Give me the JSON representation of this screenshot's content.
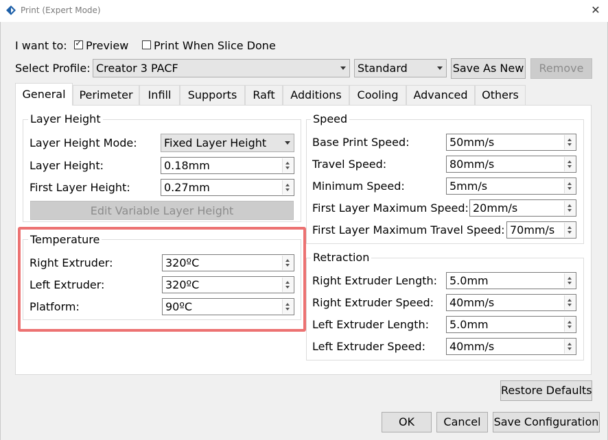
{
  "window": {
    "title": "Print (Expert Mode)",
    "close_glyph": "✕"
  },
  "mode": {
    "label": "I want to:",
    "preview": {
      "label": "Preview",
      "checked": true
    },
    "print_when_done": {
      "label": "Print When Slice Done",
      "checked": false
    }
  },
  "profile": {
    "label": "Select Profile:",
    "selected": "Creator 3 PACF",
    "quality": "Standard",
    "save_as_new": "Save As New",
    "remove": "Remove"
  },
  "tabs": [
    "General",
    "Perimeter",
    "Infill",
    "Supports",
    "Raft",
    "Additions",
    "Cooling",
    "Advanced",
    "Others"
  ],
  "layer_height": {
    "title": "Layer Height",
    "mode_label": "Layer Height Mode:",
    "mode_value": "Fixed Layer Height",
    "height_label": "Layer Height:",
    "height_value": "0.18mm",
    "first_label": "First Layer Height:",
    "first_value": "0.27mm",
    "edit_button": "Edit Variable Layer Height"
  },
  "temperature": {
    "title": "Temperature",
    "right_label": "Right Extruder:",
    "right_value": "320ºC",
    "left_label": "Left Extruder:",
    "left_value": "320ºC",
    "platform_label": "Platform:",
    "platform_value": "90ºC"
  },
  "speed": {
    "title": "Speed",
    "base_label": "Base Print Speed:",
    "base_value": "50mm/s",
    "travel_label": "Travel Speed:",
    "travel_value": "80mm/s",
    "min_label": "Minimum Speed:",
    "min_value": "5mm/s",
    "first_max_label": "First Layer Maximum Speed:",
    "first_max_value": "20mm/s",
    "first_travel_label": "First Layer Maximum Travel Speed:",
    "first_travel_value": "70mm/s"
  },
  "retraction": {
    "title": "Retraction",
    "r_len_label": "Right Extruder Length:",
    "r_len_value": "5.0mm",
    "r_spd_label": "Right Extruder Speed:",
    "r_spd_value": "40mm/s",
    "l_len_label": "Left Extruder Length:",
    "l_len_value": "5.0mm",
    "l_spd_label": "Left Extruder Speed:",
    "l_spd_value": "40mm/s"
  },
  "footer": {
    "restore": "Restore Defaults",
    "ok": "OK",
    "cancel": "Cancel",
    "save_config": "Save Configuration"
  },
  "colors": {
    "highlight": "#ec7272",
    "app_icon": "#1c5fa8"
  }
}
